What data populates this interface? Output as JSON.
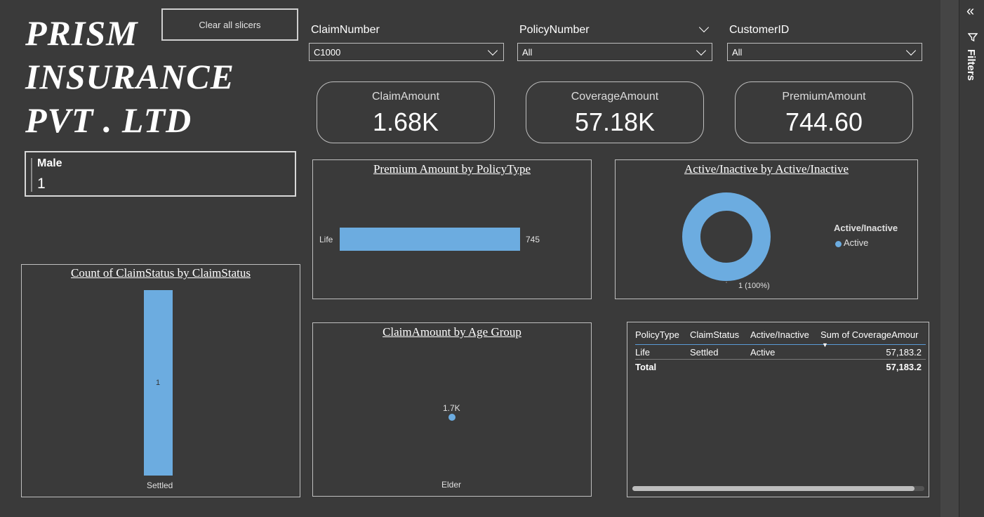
{
  "brand": {
    "line1": "PRISM",
    "line2": "INSURANCE",
    "line3": "PVT . LTD"
  },
  "clear_slicers_label": "Clear all slicers",
  "gender_card": {
    "label": "Male",
    "value": "1"
  },
  "slicers": {
    "claim": {
      "title": "ClaimNumber",
      "value": "C1000"
    },
    "policy": {
      "title": "PolicyNumber",
      "value": "All"
    },
    "customer": {
      "title": "CustomerID",
      "value": "All"
    }
  },
  "kpis": {
    "claim": {
      "label": "ClaimAmount",
      "value": "1.68K"
    },
    "coverage": {
      "label": "CoverageAmount",
      "value": "57.18K"
    },
    "premium": {
      "label": "PremiumAmount",
      "value": "744.60"
    }
  },
  "charts": {
    "premium_by_policytype": {
      "title": "Premium Amount by PolicyType",
      "category": "Life",
      "value_label": "745"
    },
    "active_inactive": {
      "title": "Active/Inactive by Active/Inactive",
      "legend_title": "Active/Inactive",
      "legend_item": "Active",
      "slice_label": "1 (100%)"
    },
    "claimamount_by_age": {
      "title": "ClaimAmount by Age Group",
      "category": "Elder",
      "value_label": "1.7K"
    },
    "claimstatus_count": {
      "title": "Count of ClaimStatus by ClaimStatus",
      "category": "Settled",
      "value_label": "1"
    }
  },
  "chart_data": [
    {
      "type": "bar",
      "title": "Premium Amount by PolicyType",
      "orientation": "horizontal",
      "categories": [
        "Life"
      ],
      "values": [
        744.6
      ],
      "color": "#6cace0"
    },
    {
      "type": "pie",
      "title": "Active/Inactive by Active/Inactive",
      "style": "donut",
      "categories": [
        "Active"
      ],
      "values": [
        1
      ],
      "legend_title": "Active/Inactive",
      "legend_placement": "right",
      "color": "#6cace0"
    },
    {
      "type": "scatter",
      "title": "ClaimAmount by Age Group",
      "categories": [
        "Elder"
      ],
      "values": [
        1680
      ],
      "color": "#6cace0"
    },
    {
      "type": "bar",
      "title": "Count of ClaimStatus by ClaimStatus",
      "orientation": "vertical",
      "categories": [
        "Settled"
      ],
      "values": [
        1
      ],
      "color": "#6cace0"
    }
  ],
  "table": {
    "headers": [
      "PolicyType",
      "ClaimStatus",
      "Active/Inactive",
      "Sum of CoverageAmour"
    ],
    "row": [
      "Life",
      "Settled",
      "Active",
      "57,183.2"
    ],
    "total": [
      "Total",
      "",
      "",
      "57,183.2"
    ]
  },
  "filters_label": "Filters",
  "colors": {
    "accent": "#6cace0",
    "background": "#3a3a3a"
  }
}
